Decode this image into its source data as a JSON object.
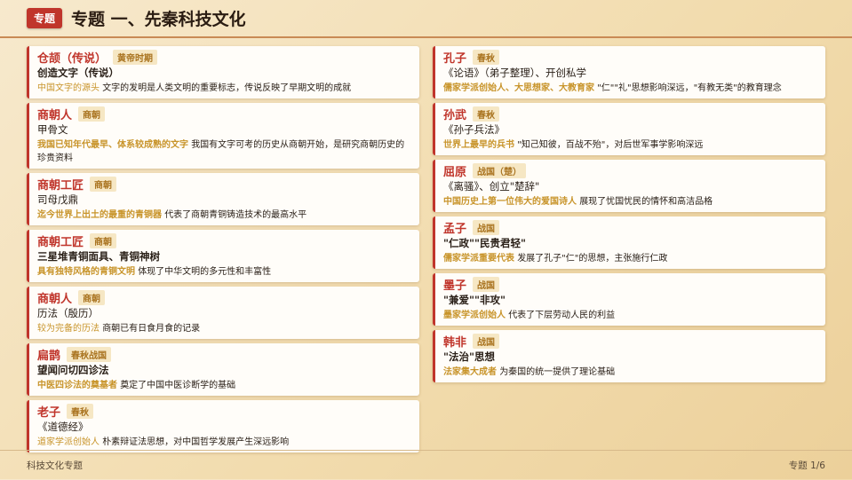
{
  "header": {
    "tag": "专题",
    "title": "专题 一、先秦科技文化"
  },
  "left": [
    {
      "name": "仓颉（传说）",
      "era": "黄帝时期",
      "work": "创造文字（传说）",
      "work_bold": true,
      "highlight": "中国文字的源头",
      "highlight_bold": false,
      "desc": "文字的发明是人类文明的重要标志，传说反映了早期文明的成就"
    },
    {
      "name": "商朝人",
      "era": "商朝",
      "work": "甲骨文",
      "work_bold": false,
      "highlight": "我国已知年代最早、体系较成熟的文字",
      "highlight_bold": true,
      "desc": "我国有文字可考的历史从商朝开始，是研究商朝历史的珍贵资料"
    },
    {
      "name": "商朝工匠",
      "era": "商朝",
      "work": "司母戊鼎",
      "work_bold": false,
      "highlight": "迄今世界上出土的最重的青铜器",
      "highlight_bold": true,
      "desc": "代表了商朝青铜铸造技术的最高水平"
    },
    {
      "name": "商朝工匠",
      "era": "商朝",
      "work": "三星堆青铜面具、青铜神树",
      "work_bold": true,
      "highlight": "具有独特风格的青铜文明",
      "highlight_bold": true,
      "desc": "体现了中华文明的多元性和丰富性"
    },
    {
      "name": "商朝人",
      "era": "商朝",
      "work": "历法（殷历）",
      "work_bold": false,
      "highlight": "较为完备的历法",
      "highlight_bold": false,
      "desc": "商朝已有日食月食的记录"
    },
    {
      "name": "扁鹊",
      "era": "春秋战国",
      "work": "望闻问切四诊法",
      "work_bold": true,
      "highlight": "中医四诊法的奠基者",
      "highlight_bold": true,
      "desc": "奠定了中国中医诊断学的基础"
    },
    {
      "name": "老子",
      "era": "春秋",
      "work": "《道德经》",
      "work_bold": false,
      "highlight": "道家学派创始人",
      "highlight_bold": false,
      "desc": "朴素辩证法思想，对中国哲学发展产生深远影响"
    }
  ],
  "right": [
    {
      "name": "孔子",
      "era": "春秋",
      "work": "《论语》（弟子整理）、开创私学",
      "work_bold": false,
      "highlight": "儒家学派创始人、大思想家、大教育家",
      "highlight_bold": true,
      "desc": "\"仁\"\"礼\"思想影响深远，\"有教无类\"的教育理念"
    },
    {
      "name": "孙武",
      "era": "春秋",
      "work": "《孙子兵法》",
      "work_bold": false,
      "highlight": "世界上最早的兵书",
      "highlight_bold": true,
      "desc": "\"知己知彼，百战不殆\"，对后世军事学影响深远"
    },
    {
      "name": "屈原",
      "era": "战国（楚）",
      "work": "《离骚》、创立\"楚辞\"",
      "work_bold": false,
      "highlight": "中国历史上第一位伟大的爱国诗人",
      "highlight_bold": true,
      "desc": "展现了忧国忧民的情怀和高洁品格"
    },
    {
      "name": "孟子",
      "era": "战国",
      "work": "\"仁政\"\"民贵君轻\"",
      "work_bold": true,
      "highlight": "儒家学派重要代表",
      "highlight_bold": true,
      "desc": "发展了孔子\"仁\"的思想，主张施行仁政"
    },
    {
      "name": "墨子",
      "era": "战国",
      "work": "\"兼爱\"\"非攻\"",
      "work_bold": true,
      "highlight": "墨家学派创始人",
      "highlight_bold": true,
      "desc": "代表了下层劳动人民的利益"
    },
    {
      "name": "韩非",
      "era": "战国",
      "work": "\"法治\"思想",
      "work_bold": true,
      "highlight": "法家集大成者",
      "highlight_bold": true,
      "desc": "为秦国的统一提供了理论基础"
    }
  ],
  "footer": {
    "left": "科技文化专题",
    "right": "专题 1/6"
  }
}
